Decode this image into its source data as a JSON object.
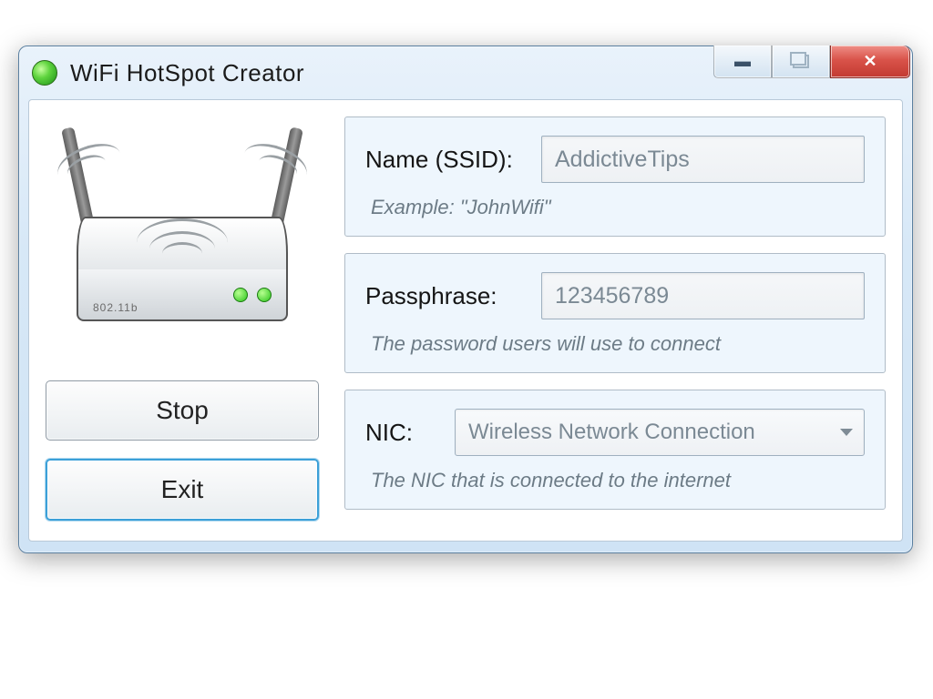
{
  "window": {
    "title": "WiFi HotSpot Creator"
  },
  "router": {
    "label": "802.11b"
  },
  "buttons": {
    "stop": "Stop",
    "exit": "Exit"
  },
  "ssid": {
    "label": "Name (SSID):",
    "value": "AddictiveTips",
    "hint": "Example: \"JohnWifi\""
  },
  "pass": {
    "label": "Passphrase:",
    "value": "123456789",
    "hint": "The password users will use to connect"
  },
  "nic": {
    "label": "NIC:",
    "value": "Wireless Network Connection",
    "hint": "The NIC that is connected to the internet"
  }
}
